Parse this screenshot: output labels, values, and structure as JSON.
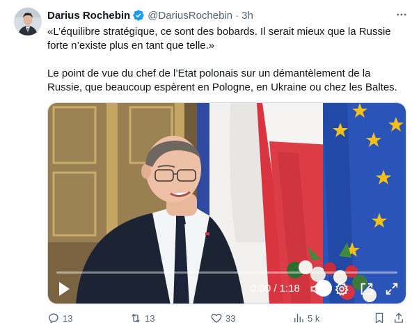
{
  "tweet": {
    "author_name": "Darius Rochebin",
    "handle": "@DariusRochebin",
    "separator": "·",
    "time": "3h",
    "paragraph1": "«L’équilibre stratégique, ce sont des bobards. Il serait mieux que la Russie forte n’existe plus en tant que telle.»",
    "paragraph2": "Le point de vue du chef de l’Etat polonais sur un démantèlement de la Russie, que beaucoup espèrent en Pologne, en Ukraine ou chez les Baltes."
  },
  "video": {
    "timecode": "0:00 / 1:18",
    "progress": 0.0
  },
  "actions": {
    "replies": "13",
    "reposts": "13",
    "likes": "33",
    "views": "5 k"
  },
  "colors": {
    "verified": "#1d9bf0",
    "secondary_text": "#536471",
    "eu_blue": "#2a54b8",
    "flag_red": "#dc3c46",
    "star_yellow": "#f3c01c"
  }
}
